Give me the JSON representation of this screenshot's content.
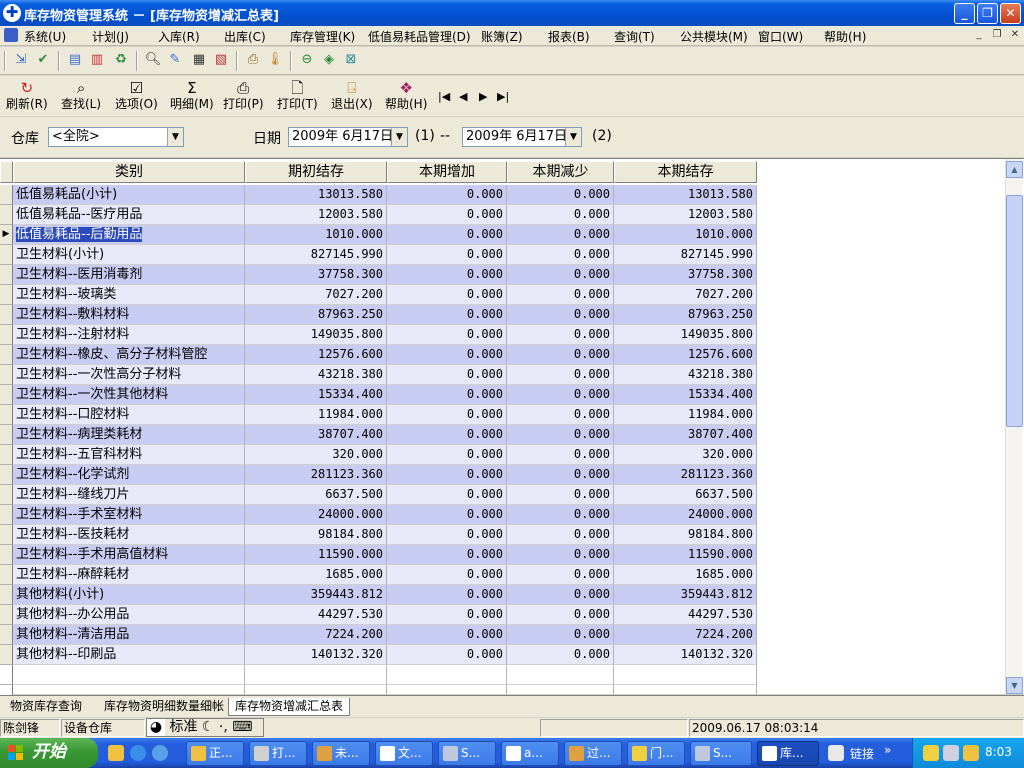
{
  "window": {
    "title": "库存物资管理系统 － [库存物资增减汇总表]",
    "controls": [
      "_",
      "❐",
      "✕"
    ]
  },
  "menu": [
    "系统(U)",
    "计划(J)",
    "入库(R)",
    "出库(C)",
    "库存管理(K)",
    "低值易耗品管理(D)",
    "账簿(Z)",
    "报表(B)",
    "查询(T)",
    "公共模块(M)",
    "窗口(W)",
    "帮助(H)"
  ],
  "toolbar2": {
    "buttons": [
      "刷新(R)",
      "查找(L)",
      "选项(O)",
      "明细(M)",
      "打印(P)",
      "打印(T)",
      "退出(X)",
      "帮助(H)"
    ]
  },
  "filter": {
    "warehouse_label": "仓库",
    "warehouse_value": "<全院>",
    "date_label": "日期",
    "date_from": "2009年 6月17日",
    "link1": "(1)",
    "dash": "--",
    "date_to": "2009年 6月17日",
    "link2": "(2)"
  },
  "table": {
    "columns": [
      "类别",
      "期初结存",
      "本期增加",
      "本期减少",
      "本期结存"
    ],
    "selected_row": 2,
    "rows": [
      [
        "低值易耗品(小计)",
        "13013.580",
        "0.000",
        "0.000",
        "13013.580"
      ],
      [
        "低值易耗品--医疗用品",
        "12003.580",
        "0.000",
        "0.000",
        "12003.580"
      ],
      [
        "低值易耗品--后勤用品",
        "1010.000",
        "0.000",
        "0.000",
        "1010.000"
      ],
      [
        "卫生材料(小计)",
        "827145.990",
        "0.000",
        "0.000",
        "827145.990"
      ],
      [
        "卫生材料--医用消毒剂",
        "37758.300",
        "0.000",
        "0.000",
        "37758.300"
      ],
      [
        "卫生材料--玻璃类",
        "7027.200",
        "0.000",
        "0.000",
        "7027.200"
      ],
      [
        "卫生材料--敷料材料",
        "87963.250",
        "0.000",
        "0.000",
        "87963.250"
      ],
      [
        "卫生材料--注射材料",
        "149035.800",
        "0.000",
        "0.000",
        "149035.800"
      ],
      [
        "卫生材料--橡皮、高分子材料管腔",
        "12576.600",
        "0.000",
        "0.000",
        "12576.600"
      ],
      [
        "卫生材料--一次性高分子材料",
        "43218.380",
        "0.000",
        "0.000",
        "43218.380"
      ],
      [
        "卫生材料--一次性其他材料",
        "15334.400",
        "0.000",
        "0.000",
        "15334.400"
      ],
      [
        "卫生材料--口腔材料",
        "11984.000",
        "0.000",
        "0.000",
        "11984.000"
      ],
      [
        "卫生材料--病理类耗材",
        "38707.400",
        "0.000",
        "0.000",
        "38707.400"
      ],
      [
        "卫生材料--五官科材料",
        "320.000",
        "0.000",
        "0.000",
        "320.000"
      ],
      [
        "卫生材料--化学试剂",
        "281123.360",
        "0.000",
        "0.000",
        "281123.360"
      ],
      [
        "卫生材料--缝线刀片",
        "6637.500",
        "0.000",
        "0.000",
        "6637.500"
      ],
      [
        "卫生材料--手术室材料",
        "24000.000",
        "0.000",
        "0.000",
        "24000.000"
      ],
      [
        "卫生材料--医技耗材",
        "98184.800",
        "0.000",
        "0.000",
        "98184.800"
      ],
      [
        "卫生材料--手术用高值材料",
        "11590.000",
        "0.000",
        "0.000",
        "11590.000"
      ],
      [
        "卫生材料--麻醉耗材",
        "1685.000",
        "0.000",
        "0.000",
        "1685.000"
      ],
      [
        "其他材料(小计)",
        "359443.812",
        "0.000",
        "0.000",
        "359443.812"
      ],
      [
        "其他材料--办公用品",
        "44297.530",
        "0.000",
        "0.000",
        "44297.530"
      ],
      [
        "其他材料--清洁用品",
        "7224.200",
        "0.000",
        "0.000",
        "7224.200"
      ],
      [
        "其他材料--印刷品",
        "140132.320",
        "0.000",
        "0.000",
        "140132.320"
      ]
    ]
  },
  "tabs": [
    "物资库存查询",
    "库存物资明细数量细帐",
    "库存物资增减汇总表"
  ],
  "active_tab": 2,
  "status": {
    "user": "陈剑锋",
    "dept": "设备仓库",
    "ime_mode": "标准",
    "datetime": "2009.06.17  08:03:14"
  },
  "taskbar": {
    "start": "开始",
    "tasks": [
      "正...",
      "打...",
      "未...",
      "文...",
      "S...",
      "a...",
      "过...",
      "门...",
      "S...",
      "库..."
    ],
    "active_task": 9,
    "links_label": "链接",
    "clock": "8:03"
  },
  "colors": {
    "row_odd": "#c9ccf2",
    "row_even": "#e7e8f8",
    "selection": "#2c4bb8",
    "titlebar": "#0050d0"
  }
}
